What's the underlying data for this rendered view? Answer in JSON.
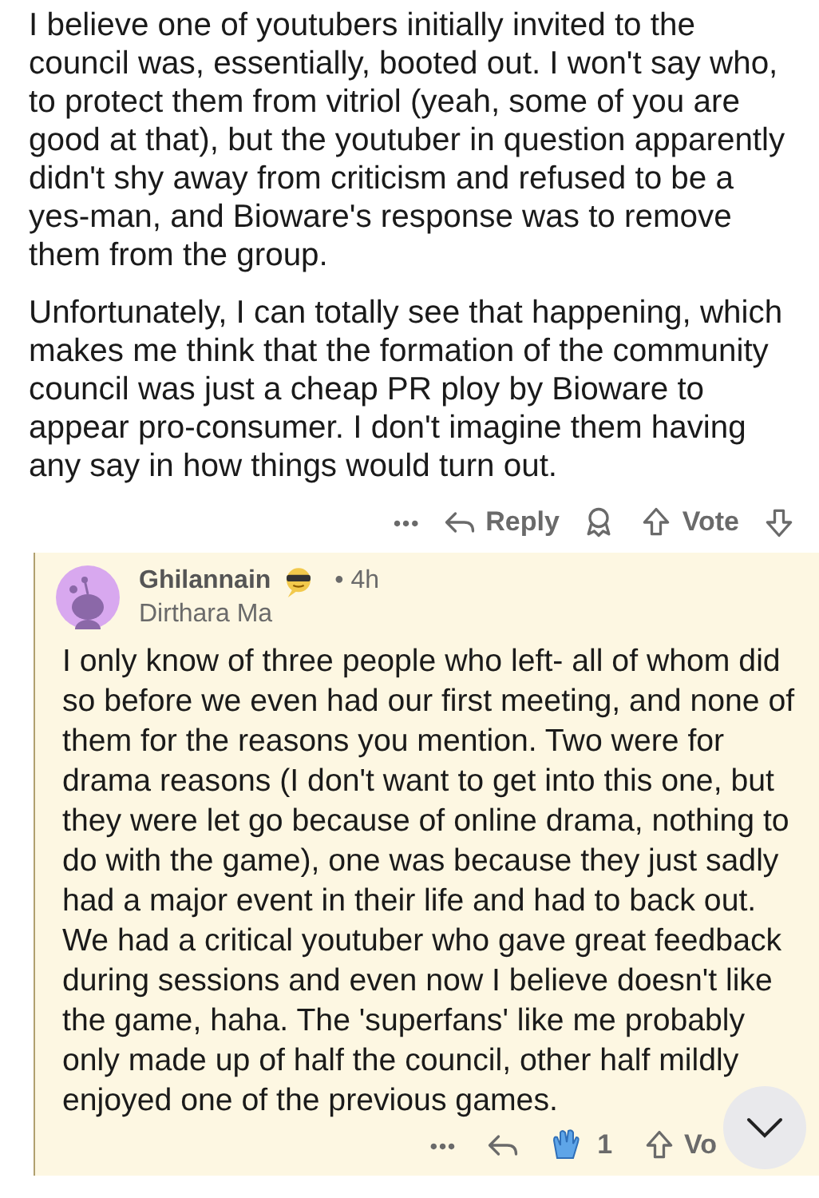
{
  "parent_comment": {
    "paragraphs": [
      "I believe one of youtubers initially invited to the council was, essentially, booted out. I won't say who, to protect them from vitriol (yeah, some of you are good at that), but the youtuber in question apparently didn't shy away from criticism and refused to be a yes-man, and Bioware's response was to remove them from the group.",
      "Unfortunately, I can totally see that happening, which makes me think that the formation of the community council was just a cheap PR ploy by Bioware to appear pro-consumer. I don't imagine them having any say in how things would turn out."
    ],
    "actions": {
      "more": "•••",
      "reply": "Reply",
      "vote": "Vote"
    }
  },
  "reply": {
    "author": "Ghilannain",
    "age": "• 4h",
    "flair": "Dirthara Ma",
    "body": "I only know of three people who left- all of whom did so before we even had our first meeting, and none of them for the reasons you mention. Two were for drama reasons (I don't want to get into this one, but they were let go because of online drama, nothing to do with the game), one was because they just sadly had a major event in their life and had to back out. We had a critical youtuber who gave great feedback during sessions and even now I believe doesn't like the game, haha.  The 'superfans' like me probably only made up of half the council, other half mildly enjoyed one of the previous games.",
    "actions": {
      "more": "•••",
      "award_count": "1",
      "vote": "Vo"
    }
  }
}
